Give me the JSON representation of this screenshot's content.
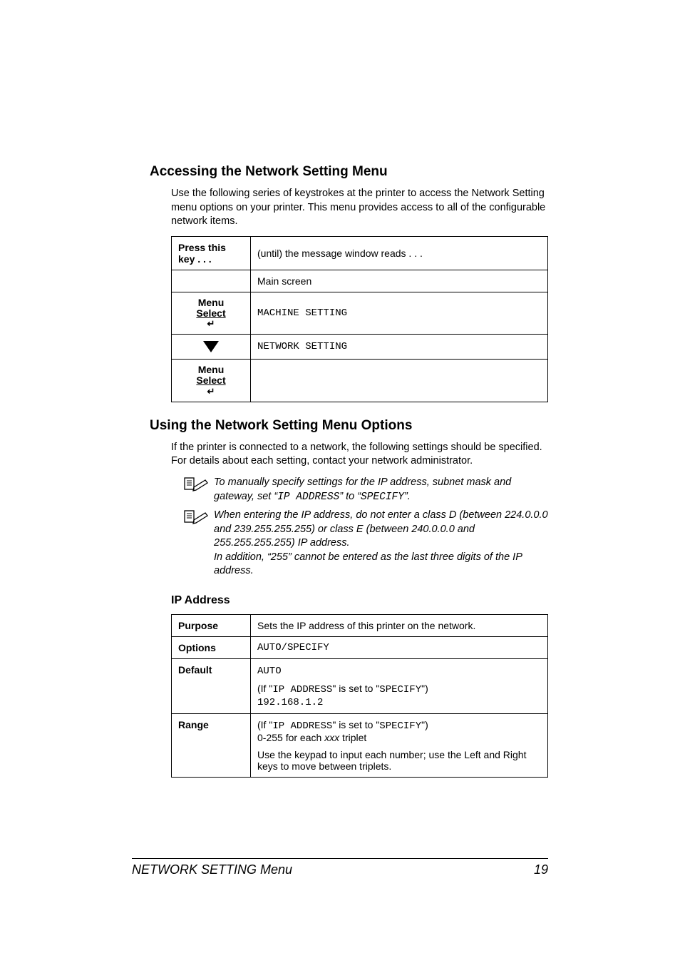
{
  "headings": {
    "section1": "Accessing the Network Setting Menu",
    "section2": "Using the Network Setting Menu Options",
    "sub_ipaddr": "IP Address"
  },
  "body": {
    "intro1": "Use the following series of keystrokes at the printer to access the Network Setting menu options on your printer. This menu provides access to all of the configurable network items.",
    "intro2": "If the printer is connected to a network, the following settings should be specified. For details about each setting, contact your network administrator."
  },
  "key_table": {
    "header_left": "Press this key . . .",
    "header_right": "(until) the message window reads . . .",
    "rows": [
      {
        "key_type": "blank",
        "msg": "Main screen",
        "msg_plain": true
      },
      {
        "key_type": "menu_select",
        "msg": "MACHINE SETTING"
      },
      {
        "key_type": "down",
        "msg": "NETWORK SETTING"
      },
      {
        "key_type": "menu_select",
        "msg": ""
      }
    ],
    "menu_label_l1": "Menu",
    "menu_label_l2": "Select"
  },
  "notes": {
    "n1_pre": "To manually specify settings for the IP address, subnet mask and gateway, set “",
    "n1_code": "IP ADDRESS",
    "n1_mid": "” to “",
    "n1_code2": "SPECIFY",
    "n1_post": "”.",
    "n2_l1": "When entering the IP address, do not enter a class D (between 224.0.0.0 and 239.255.255.255) or class E (between 240.0.0.0 and 255.255.255.255) IP address.",
    "n2_l2": "In addition, “255” cannot be entered as the last three digits of the IP address."
  },
  "ipaddr_table": {
    "purpose_label": "Purpose",
    "purpose_text": "Sets the IP address of this printer on the network.",
    "options_label": "Options",
    "options_text": "AUTO/SPECIFY",
    "default_label": "Default",
    "default_line1": "AUTO",
    "default_if_pre": "(If \"",
    "default_if_code1": "IP ADDRESS",
    "default_if_mid": "\" is set to \"",
    "default_if_code2": "SPECIFY",
    "default_if_post": "\")",
    "default_ip": "192.168.1.2",
    "range_label": "Range",
    "range_if_pre": "(If \"",
    "range_if_code1": "IP ADDRESS",
    "range_if_mid": "\" is set to \"",
    "range_if_code2": "SPECIFY",
    "range_if_post": "\")",
    "range_line2_pre": "0-255 for each ",
    "range_line2_it": "xxx",
    "range_line2_post": " triplet",
    "range_line3": "Use the keypad to input each number; use the Left and Right keys to move between triplets."
  },
  "footer": {
    "left": "NETWORK SETTING Menu",
    "right": "19"
  }
}
